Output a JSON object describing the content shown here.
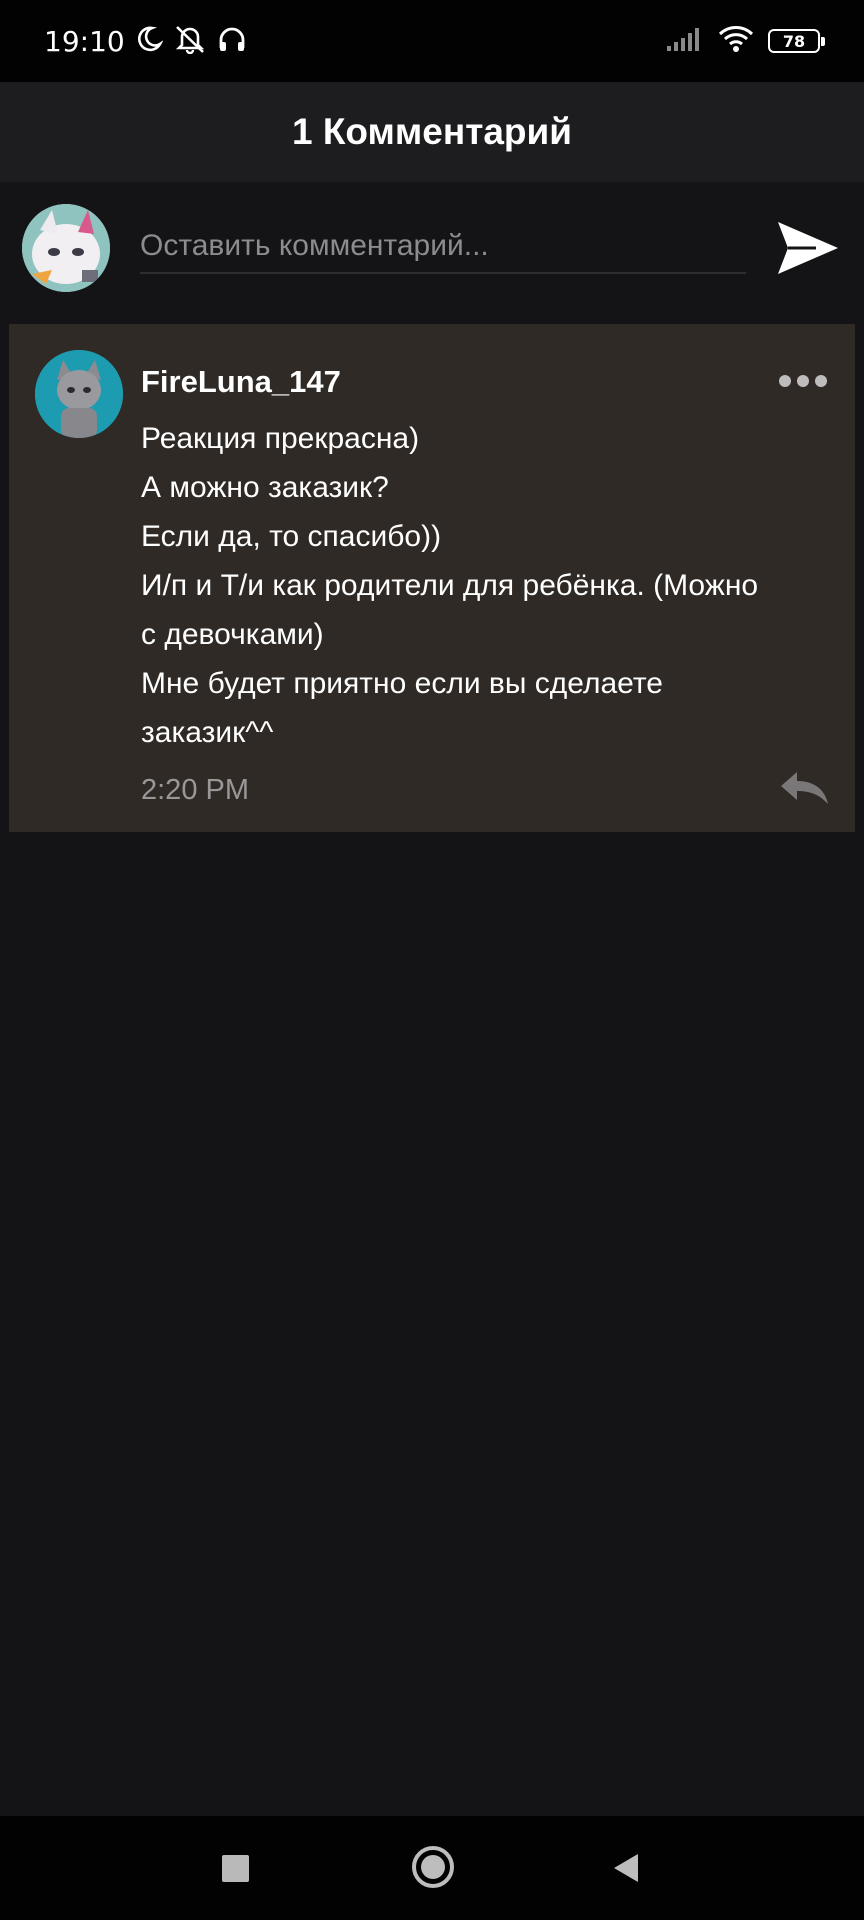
{
  "status_bar": {
    "time": "19:10",
    "battery": "78",
    "icons": [
      "moon-icon",
      "silent-bell-icon",
      "headphones-icon",
      "signal-icon",
      "wifi-icon",
      "battery-icon"
    ]
  },
  "header": {
    "title": "1 Комментарий"
  },
  "compose": {
    "placeholder": "Оставить комментарий...",
    "value": "",
    "send_icon": "send-icon"
  },
  "comment": {
    "author": "FireLuna_147",
    "lines": [
      "Реакция прекрасна)",
      "А можно заказик?",
      "Если да, то спасибо))",
      "И/п и Т/и как родители для ребёнка. (Можно",
      "с девочками)",
      "Мне будет приятно если вы сделаете",
      "заказик^^"
    ],
    "time": "2:20 PM",
    "more_icon": "more-dots-icon",
    "reply_icon": "reply-icon"
  },
  "colors": {
    "background": "#141316",
    "header": "#1d1d20",
    "card": "#2f2a26",
    "muted_text": "#9b9799"
  }
}
